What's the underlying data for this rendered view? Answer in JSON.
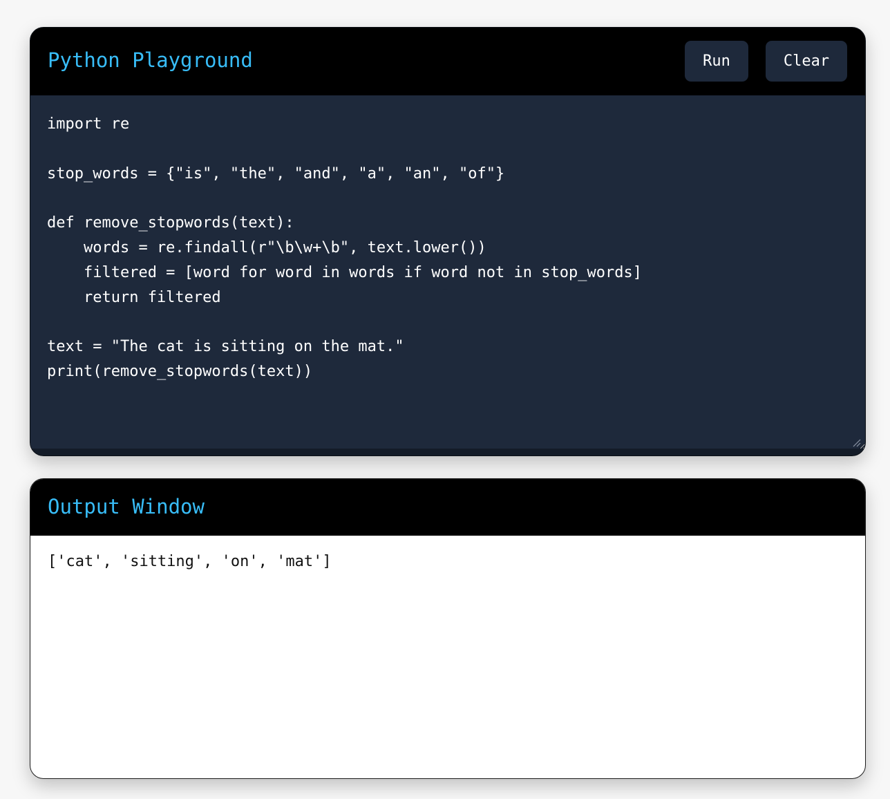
{
  "editor": {
    "title": "Python Playground",
    "run_label": "Run",
    "clear_label": "Clear",
    "code": "import re\n\nstop_words = {\"is\", \"the\", \"and\", \"a\", \"an\", \"of\"}\n\ndef remove_stopwords(text):\n    words = re.findall(r\"\\b\\w+\\b\", text.lower())\n    filtered = [word for word in words if word not in stop_words]\n    return filtered\n\ntext = \"The cat is sitting on the mat.\"\nprint(remove_stopwords(text))"
  },
  "output": {
    "title": "Output Window",
    "text": "['cat', 'sitting', 'on', 'mat']"
  },
  "colors": {
    "accent": "#38bdf8",
    "header_bg": "#000000",
    "editor_bg": "#1e293b",
    "output_bg": "#ffffff"
  },
  "icons": {
    "resize": "resize-grip-icon"
  }
}
